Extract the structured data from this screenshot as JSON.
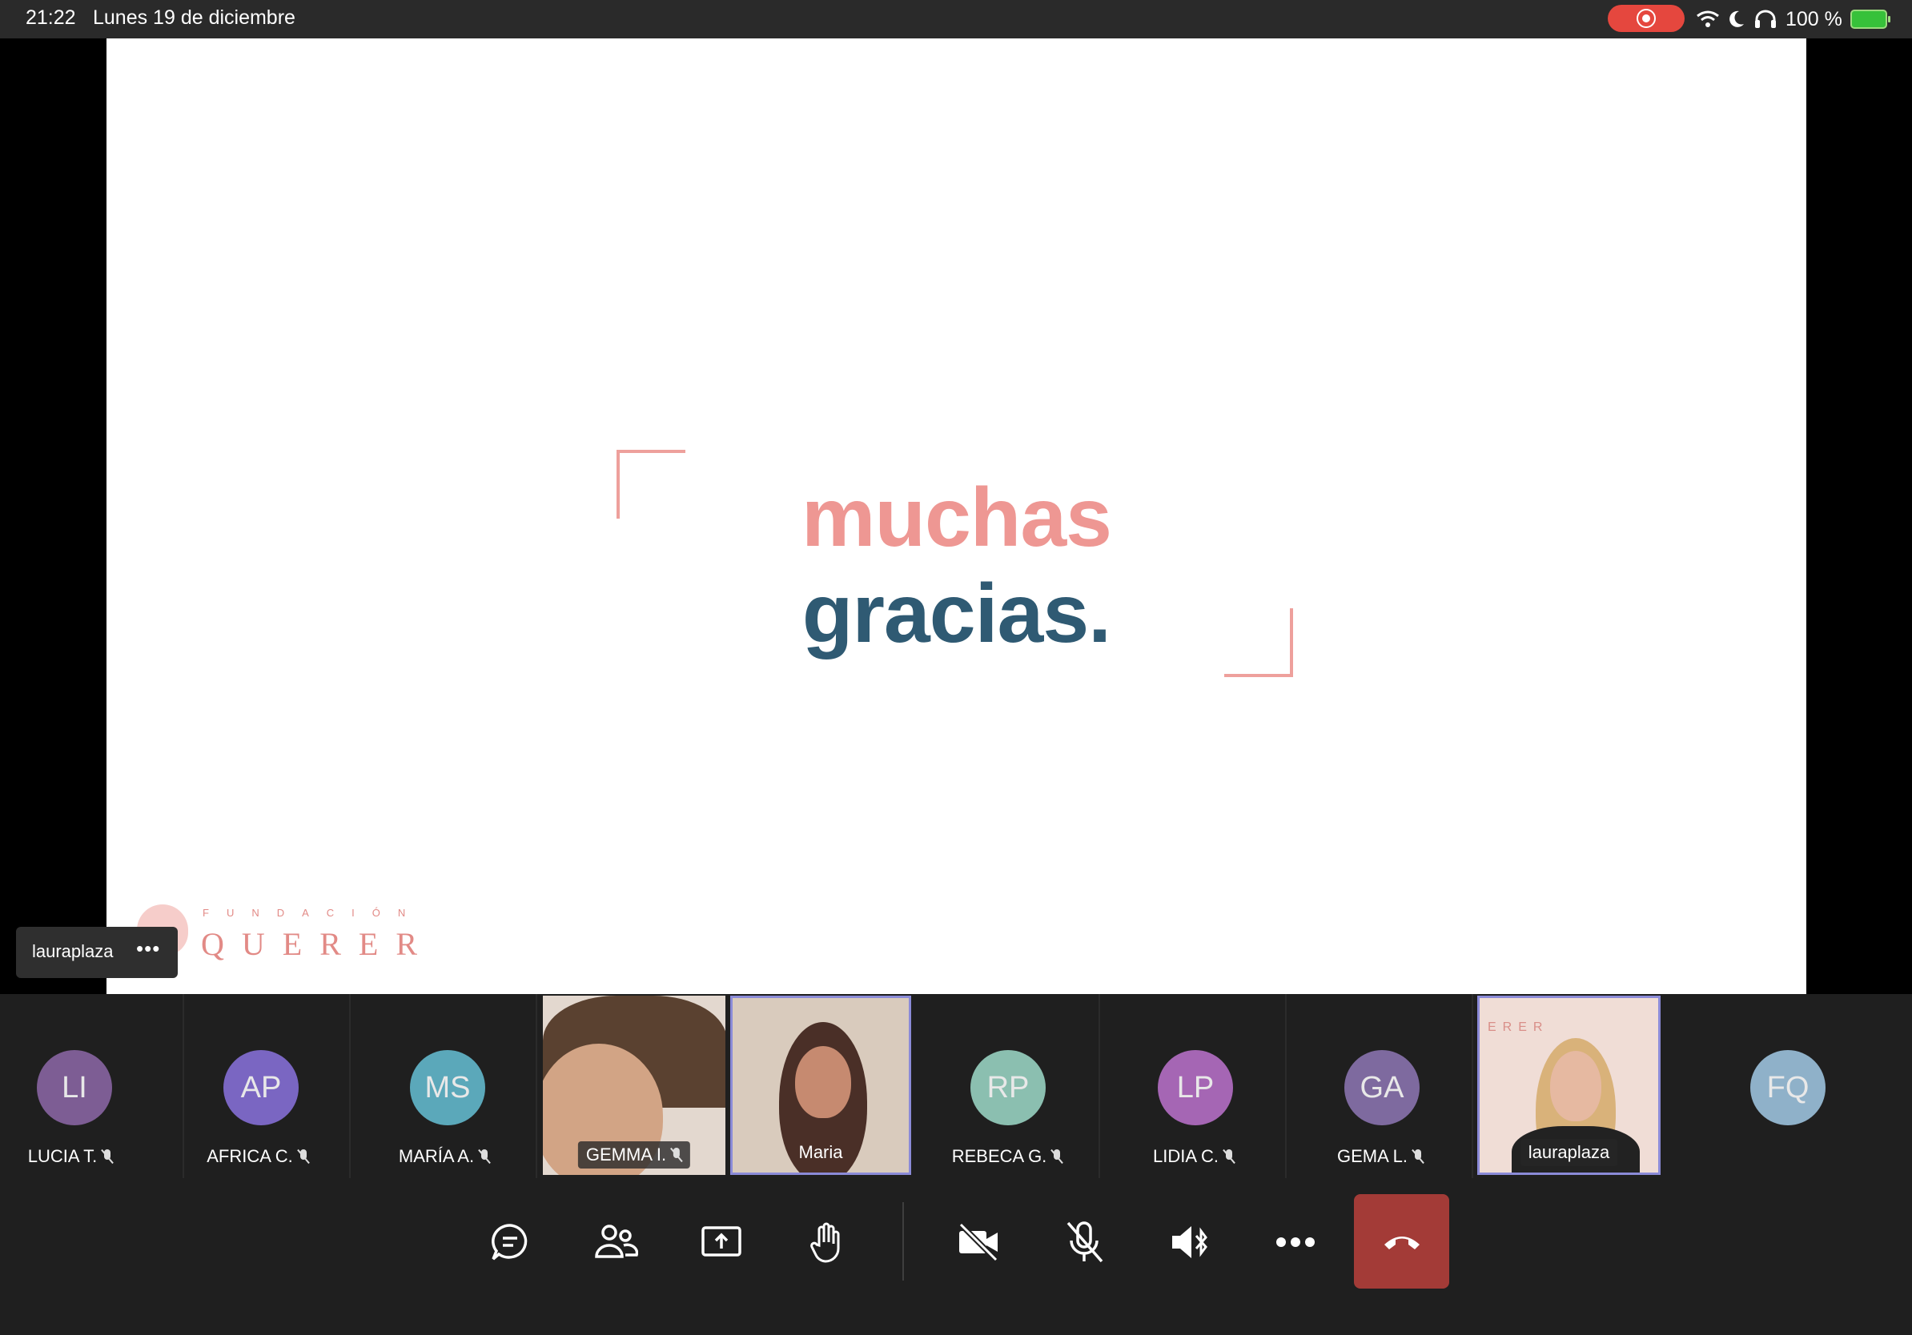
{
  "status_bar": {
    "time": "21:22",
    "date": "Lunes 19 de diciembre",
    "battery": "100 %",
    "recording_color": "#e5473e"
  },
  "slide": {
    "line1": "muchas",
    "line2": "gracias.",
    "logo_small": "FUNDACIÓN",
    "logo_big": "QUERER",
    "colors": {
      "pink": "#ee9793",
      "blue": "#2f5a73"
    }
  },
  "presenter": {
    "name": "lauraplaza",
    "more_label": "•••"
  },
  "participants": [
    {
      "initials": "LI",
      "name": "LUCIA T.",
      "color": "#7d5d94",
      "muted": true
    },
    {
      "initials": "AP",
      "name": "AFRICA C.",
      "color": "#7a66c2",
      "muted": true
    },
    {
      "initials": "MS",
      "name": "MARÍA A.",
      "color": "#5ba8ba",
      "muted": true
    },
    {
      "name": "GEMMA I.",
      "video": true,
      "muted": true
    },
    {
      "name": "Maria",
      "video": true,
      "muted": false,
      "active": true
    },
    {
      "initials": "RP",
      "name": "REBECA G.",
      "color": "#8bbfb0",
      "muted": true
    },
    {
      "initials": "LP",
      "name": "LIDIA C.",
      "color": "#a566b4",
      "muted": true
    },
    {
      "initials": "GA",
      "name": "GEMA L.",
      "color": "#7e6a9f",
      "muted": true
    },
    {
      "name": "lauraplaza",
      "video": true,
      "muted": false,
      "active": true,
      "overlay_text": "ERER"
    },
    {
      "initials": "FQ",
      "color": "#8fb1c9"
    }
  ],
  "toolbar": {
    "buttons": [
      "chat-icon",
      "participants-icon",
      "share-screen-icon",
      "raise-hand-icon",
      "camera-off-icon",
      "mic-off-icon",
      "speaker-bluetooth-icon",
      "more-icon",
      "hang-up-icon"
    ],
    "hangup_color": "#a33b37"
  }
}
